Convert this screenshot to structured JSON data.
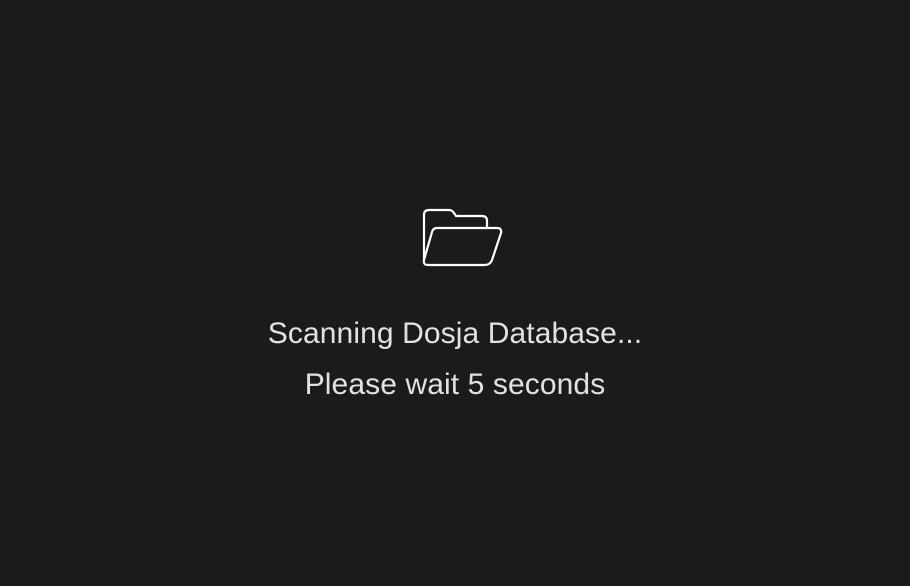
{
  "loading": {
    "icon": "folder-open-icon",
    "title": "Scanning Dosja Database...",
    "subtitle": "Please wait 5 seconds"
  },
  "colors": {
    "background": "#1b1b1b",
    "text": "#e2e2e2",
    "icon": "#ffffff"
  }
}
